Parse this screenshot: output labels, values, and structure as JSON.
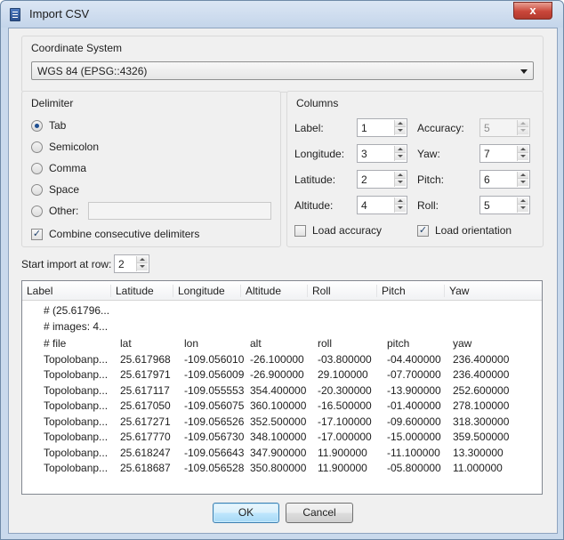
{
  "window": {
    "title": "Import CSV",
    "close_label": "x"
  },
  "coordinate_system": {
    "group_label": "Coordinate System",
    "selected": "WGS 84 (EPSG::4326)"
  },
  "delimiter": {
    "group_label": "Delimiter",
    "options": [
      "Tab",
      "Semicolon",
      "Comma",
      "Space",
      "Other:"
    ],
    "selected": "Tab",
    "other_value": "",
    "combine_label": "Combine consecutive delimiters",
    "combine_checked": true
  },
  "columns": {
    "group_label": "Columns",
    "label": {
      "caption": "Label:",
      "value": "1"
    },
    "longitude": {
      "caption": "Longitude:",
      "value": "3"
    },
    "latitude": {
      "caption": "Latitude:",
      "value": "2"
    },
    "altitude": {
      "caption": "Altitude:",
      "value": "4"
    },
    "accuracy": {
      "caption": "Accuracy:",
      "value": "5",
      "enabled": false
    },
    "yaw": {
      "caption": "Yaw:",
      "value": "7"
    },
    "pitch": {
      "caption": "Pitch:",
      "value": "6"
    },
    "roll": {
      "caption": "Roll:",
      "value": "5"
    },
    "load_accuracy": {
      "label": "Load accuracy",
      "checked": false
    },
    "load_orientation": {
      "label": "Load orientation",
      "checked": true
    }
  },
  "start_row": {
    "label": "Start import at row:",
    "value": "2"
  },
  "preview": {
    "headers": [
      "Label",
      "Latitude",
      "Longitude",
      "Altitude",
      "Roll",
      "Pitch",
      "Yaw"
    ],
    "comment_rows": [
      "# (25.61796...",
      "# images: 4..."
    ],
    "rows": [
      [
        "# file",
        "lat",
        "lon",
        "alt",
        "roll",
        "pitch",
        "yaw"
      ],
      [
        "Topolobanp...",
        "25.617968",
        "-109.056010",
        "-26.100000",
        "-03.800000",
        "-04.400000",
        "236.400000"
      ],
      [
        "Topolobanp...",
        "25.617971",
        "-109.056009",
        "-26.900000",
        "29.100000",
        "-07.700000",
        "236.400000"
      ],
      [
        "Topolobanp...",
        "25.617117",
        "-109.055553",
        "354.400000",
        "-20.300000",
        "-13.900000",
        "252.600000"
      ],
      [
        "Topolobanp...",
        "25.617050",
        "-109.056075",
        "360.100000",
        "-16.500000",
        "-01.400000",
        "278.100000"
      ],
      [
        "Topolobanp...",
        "25.617271",
        "-109.056526",
        "352.500000",
        "-17.100000",
        "-09.600000",
        "318.300000"
      ],
      [
        "Topolobanp...",
        "25.617770",
        "-109.056730",
        "348.100000",
        "-17.000000",
        "-15.000000",
        "359.500000"
      ],
      [
        "Topolobanp...",
        "25.618247",
        "-109.056643",
        "347.900000",
        "11.900000",
        "-11.100000",
        "13.300000"
      ],
      [
        "Topolobanp...",
        "25.618687",
        "-109.056528",
        "350.800000",
        "11.900000",
        "-05.800000",
        "11.000000"
      ]
    ]
  },
  "buttons": {
    "ok": "OK",
    "cancel": "Cancel"
  }
}
